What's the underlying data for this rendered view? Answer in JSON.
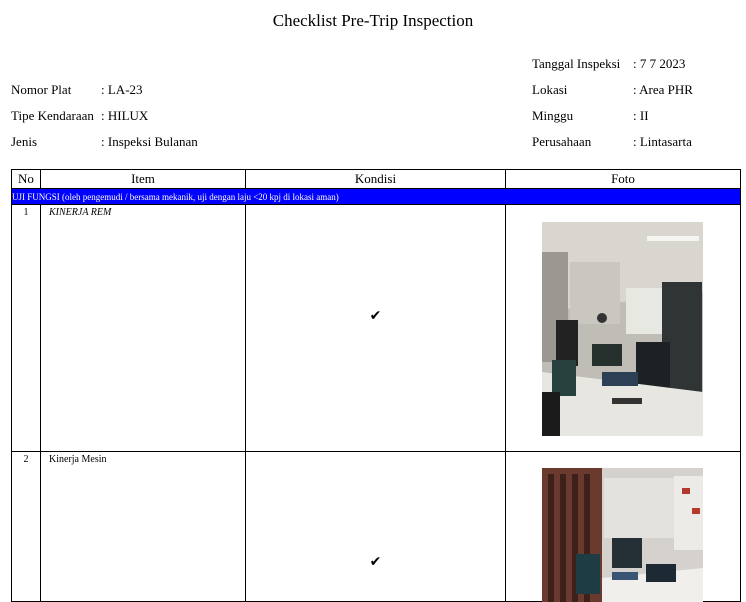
{
  "document": {
    "title": "Checklist Pre-Trip Inspection"
  },
  "vehicle": {
    "plate_label": "Nomor Plat",
    "plate_value": ": LA-23",
    "type_label": "Tipe Kendaraan",
    "type_value": ": HILUX",
    "kind_label": "Jenis",
    "kind_value": ": Inspeksi Bulanan"
  },
  "inspection": {
    "date_label": "Tanggal Inspeksi",
    "date_value": ": 7 7 2023",
    "location_label": "Lokasi",
    "location_value": ": Area PHR",
    "week_label": "Minggu",
    "week_value": ": II",
    "company_label": "Perusahaan",
    "company_value": ": Lintasarta"
  },
  "table": {
    "headers": {
      "no": "No",
      "item": "Item",
      "kondisi": "Kondisi",
      "foto": "Foto"
    },
    "section": "UJI FUNGSI (oleh pengemudi / bersama mekanik, uji dengan laju <20 kpj di lokasi aman)",
    "rows": [
      {
        "no": "1",
        "item": "KINERJA REM",
        "kondisi": "✔"
      },
      {
        "no": "2",
        "item": "Kinerja Mesin",
        "kondisi": "✔"
      }
    ]
  },
  "colors": {
    "section_background": "#0000ff",
    "section_text": "#ffffff"
  }
}
